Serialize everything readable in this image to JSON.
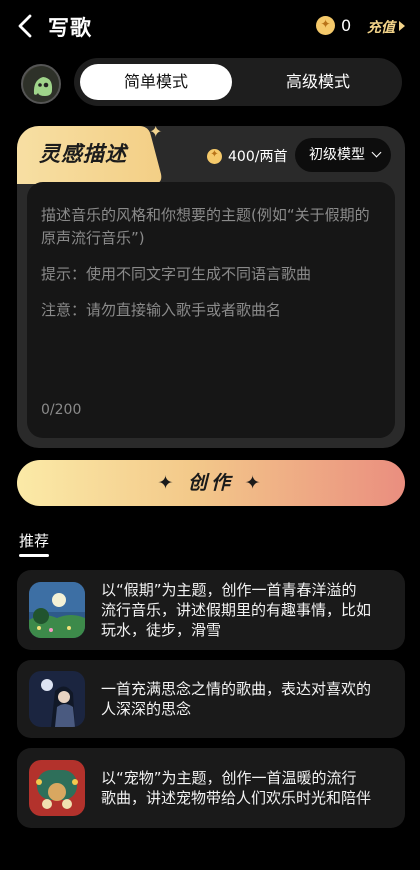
{
  "header": {
    "title": "写歌",
    "coin_count": "0",
    "recharge_label": "充值"
  },
  "modes": {
    "simple": "简单模式",
    "advanced": "高级模式"
  },
  "card": {
    "tab_label": "灵感描述",
    "cost": "400/两首",
    "model": "初级模型",
    "placeholder_lines": [
      "描述音乐的风格和你想要的主题(例如“关于假期的",
      "原声流行音乐”)"
    ],
    "hint": "提示：使用不同文字可生成不同语言歌曲",
    "note": "注意：请勿直接输入歌手或者歌曲名",
    "char_count": "0/200"
  },
  "create_button": "✦ 创作 ✦",
  "recommend": {
    "title": "推荐",
    "items": [
      {
        "lines": [
          "以“假期”为主题，创作一首青春洋溢的",
          "流行音乐，讲述假期里的有趣事情，比如",
          "玩水，徒步，滑雪"
        ]
      },
      {
        "lines": [
          "一首充满思念之情的歌曲，表达对喜欢的",
          "人深深的思念"
        ]
      },
      {
        "lines": [
          "以“宠物”为主题，创作一首温暖的流行",
          "歌曲，讲述宠物带给人们欢乐时光和陪伴"
        ]
      }
    ]
  },
  "icons": {
    "back": "back-arrow-icon",
    "coin": "coin-icon",
    "chevron": "chevron-down-icon",
    "avatar": "mascot-avatar"
  },
  "colors": {
    "accent_gold": "#f3d48a",
    "gradient_start": "#fbeaa7",
    "gradient_end": "#ea8e7f"
  }
}
